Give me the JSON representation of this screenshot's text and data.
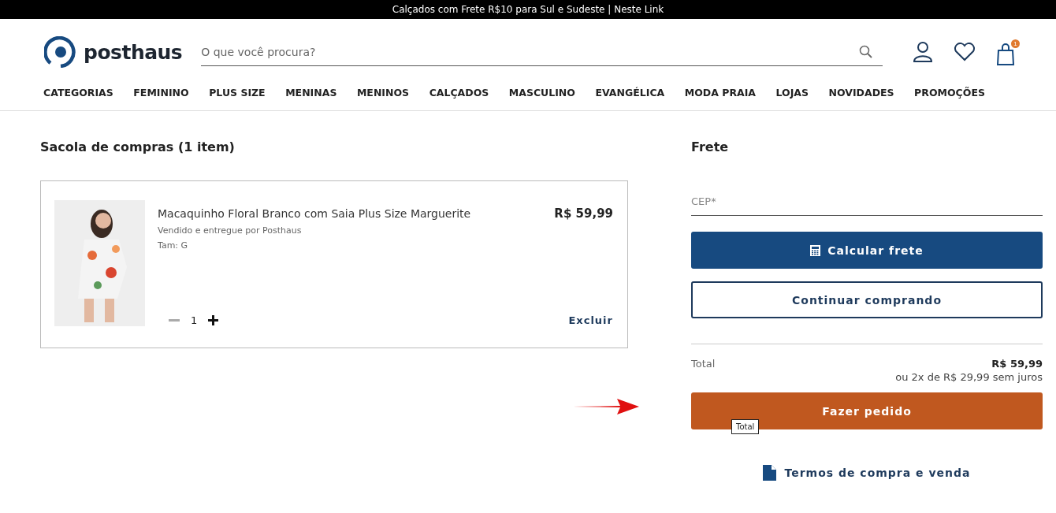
{
  "announcement": "Calçados com Frete R$10 para Sul e Sudeste | Neste Link",
  "header": {
    "logo": "posthaus",
    "search": {
      "placeholder": "O que você procura?"
    },
    "cart_count": "1"
  },
  "nav": [
    "CATEGORIAS",
    "FEMININO",
    "PLUS SIZE",
    "MENINAS",
    "MENINOS",
    "CALÇADOS",
    "MASCULINO",
    "EVANGÉLICA",
    "MODA PRAIA",
    "LOJAS",
    "NOVIDADES",
    "PROMOÇÕES"
  ],
  "cart": {
    "title": "Sacola de compras (1 item)",
    "items": [
      {
        "name": "Macaquinho Floral Branco com Saia Plus Size Marguerite",
        "seller": "Vendido e entregue por Posthaus",
        "size": "Tam: G",
        "price": "R$ 59,99",
        "quantity": "1",
        "remove": "Excluir",
        "kind": "picture"
      }
    ]
  },
  "shipping": {
    "title": "Frete",
    "cep": {
      "placeholder": "CEP*"
    },
    "calculate": "Calcular frete",
    "continue": "Continuar comprando"
  },
  "summary": {
    "total_label": "Total",
    "total": "R$ 59,99",
    "installments": "ou 2x de R$ 29,99 sem juros",
    "order": "Fazer pedido",
    "tooltip": "Total",
    "terms": "Termos de compra e venda"
  }
}
